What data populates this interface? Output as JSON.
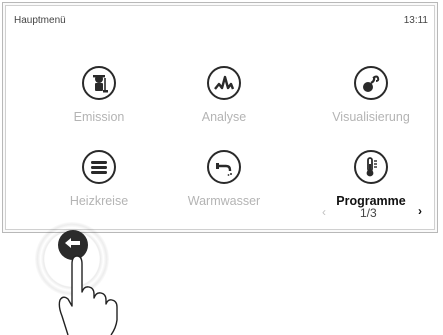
{
  "header": {
    "title": "Hauptmenü",
    "time": "13:11"
  },
  "menu": {
    "tiles": [
      {
        "label": "Emission",
        "icon": "chimney-sweep-icon",
        "active": false
      },
      {
        "label": "Analyse",
        "icon": "analysis-wave-icon",
        "active": false
      },
      {
        "label": "Visualisierung",
        "icon": "flame-pipe-icon",
        "active": false
      },
      {
        "label": "Heizkreise",
        "icon": "radiator-icon",
        "active": false
      },
      {
        "label": "Warmwasser",
        "icon": "faucet-icon",
        "active": false
      },
      {
        "label": "Programme",
        "icon": "thermometer-icon",
        "active": true
      }
    ]
  },
  "pager": {
    "prev": "‹",
    "page": "1/3",
    "next": "›"
  },
  "back": {
    "icon": "back-arrow-icon"
  },
  "colors": {
    "accent": "#2a2a2a",
    "inactive_label": "#b4b4b4",
    "active_label": "#111111"
  }
}
